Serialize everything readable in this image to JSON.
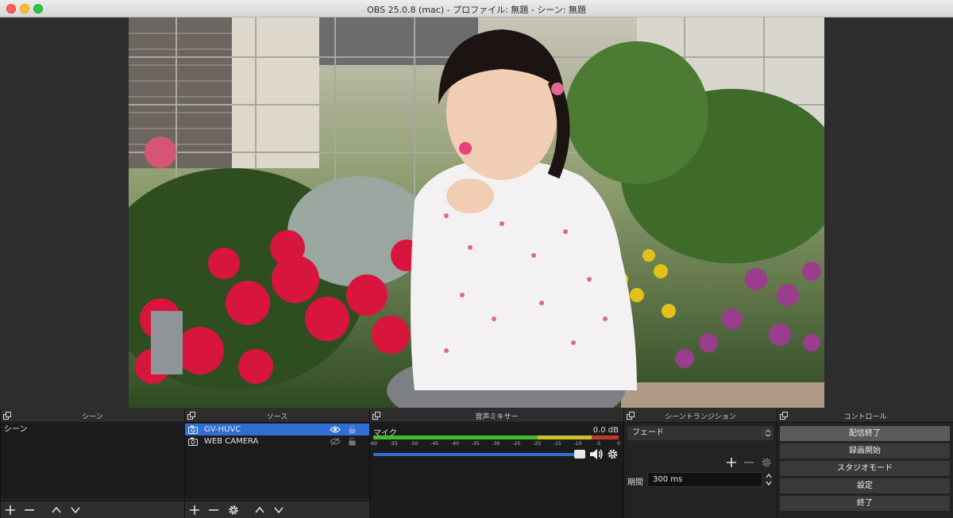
{
  "window": {
    "title": "OBS 25.0.8 (mac) - プロファイル: 無題 - シーン: 無題"
  },
  "docks": {
    "scenes": {
      "title": "シーン",
      "items": [
        "シーン"
      ]
    },
    "sources": {
      "title": "ソース",
      "items": [
        {
          "label": "GV-HUVC",
          "selected": true
        },
        {
          "label": "WEB CAMERA",
          "selected": false
        }
      ]
    },
    "mixer": {
      "title": "音声ミキサー",
      "channel": "マイク",
      "level": "0.0 dB",
      "ticks": [
        "-60",
        "-55",
        "-50",
        "-45",
        "-40",
        "-35",
        "-30",
        "-25",
        "-20",
        "-15",
        "-10",
        "-5",
        "0"
      ],
      "volume_fraction": 0.97
    },
    "transitions": {
      "title": "シーントランジション",
      "selected": "フェード",
      "duration_label": "期間",
      "duration_value": "300 ms"
    },
    "controls": {
      "title": "コントロール",
      "buttons": [
        "配信終了",
        "録画開始",
        "スタジオモード",
        "設定",
        "終了"
      ]
    }
  },
  "colors": {
    "selection": "#2f6fd3",
    "meter_green": "#3fbf2f",
    "meter_yellow": "#c8c42a",
    "meter_red": "#c23a2a"
  }
}
